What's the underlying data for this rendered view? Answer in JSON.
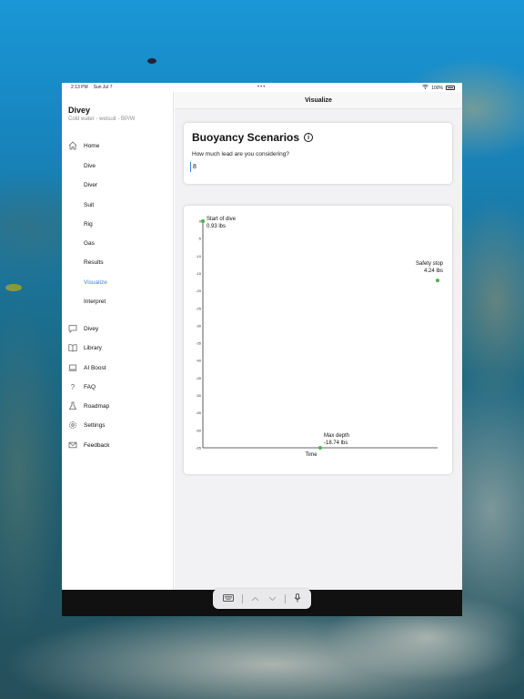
{
  "status": {
    "time": "2:13 PM",
    "date": "Sun Jul 7",
    "dots": "•••",
    "battery": "100%"
  },
  "sidebar": {
    "title": "Divey",
    "subtitle": "Cold water - wetsuit - BP/W",
    "items": [
      {
        "label": "Home",
        "icon": "house-icon",
        "sub": false
      },
      {
        "label": "Dive",
        "sub": true
      },
      {
        "label": "Diver",
        "sub": true
      },
      {
        "label": "Suit",
        "sub": true
      },
      {
        "label": "Rig",
        "sub": true
      },
      {
        "label": "Gas",
        "sub": true
      },
      {
        "label": "Results",
        "sub": true
      },
      {
        "label": "Visualize",
        "sub": true,
        "active": true
      },
      {
        "label": "Interpret",
        "sub": true
      },
      {
        "label": "Divey",
        "icon": "chat-bubble-icon",
        "sub": false
      },
      {
        "label": "Library",
        "icon": "book-icon",
        "sub": false
      },
      {
        "label": "AI Boost",
        "icon": "laptop-icon",
        "sub": false
      },
      {
        "label": "FAQ",
        "icon": "question-icon",
        "sub": false
      },
      {
        "label": "Roadmap",
        "icon": "flask-icon",
        "sub": false
      },
      {
        "label": "Settings",
        "icon": "gear-icon",
        "sub": false
      },
      {
        "label": "Feedback",
        "icon": "envelope-icon",
        "sub": false
      }
    ]
  },
  "main": {
    "nav_title": "Visualize",
    "card": {
      "heading": "Buoyancy Scenarios",
      "info_icon": "ⓘ",
      "question": "How much lead are you considering?",
      "input_value": "8"
    }
  },
  "colors": {
    "accent": "#3f7fe0",
    "point": "#4caf50"
  },
  "keyboard_bar": {
    "icons": [
      "keyboard-icon",
      "chevron-up-icon",
      "chevron-down-icon",
      "microphone-icon"
    ]
  },
  "chart_data": {
    "type": "scatter",
    "title": "",
    "xlabel": "Time",
    "ylabel": "",
    "ylim": [
      -65,
      0
    ],
    "yticks": [
      0,
      -5,
      -10,
      -15,
      -20,
      -25,
      -30,
      -35,
      -40,
      -45,
      -50,
      -55,
      -60,
      -65
    ],
    "ytick_labels": [
      "0",
      "-5",
      "-10",
      "-15",
      "-20",
      "-25",
      "-30",
      "-35",
      "-40",
      "-45",
      "-50",
      "-55",
      "-60",
      "-65"
    ],
    "grid": false,
    "points": [
      {
        "x": 0,
        "y": 0,
        "label": "Start of dive",
        "value_label": "0.93 lbs"
      },
      {
        "x": 0.5,
        "y": -65,
        "label": "Max depth",
        "value_label": "-18.74 lbs"
      },
      {
        "x": 1,
        "y": -17,
        "label": "Safety stop",
        "value_label": "4.24 lbs"
      }
    ]
  }
}
